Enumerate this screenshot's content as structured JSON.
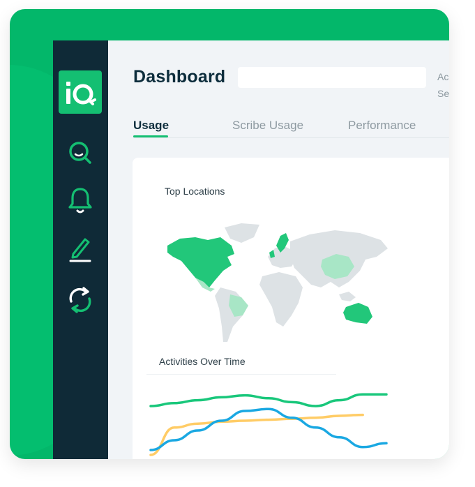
{
  "brand": {
    "logo_text": "iQ",
    "frame_color": "#03b76a",
    "accent": "#14bf72",
    "sidebar_color": "#0f2a37"
  },
  "sidebar": {
    "items": [
      {
        "icon": "search-icon"
      },
      {
        "icon": "bell-icon"
      },
      {
        "icon": "pencil-icon"
      },
      {
        "icon": "refresh-icon"
      }
    ]
  },
  "header": {
    "title": "Dashboard",
    "search_value": "",
    "trunc_1": "Ac",
    "trunc_2": "Se"
  },
  "tabs": [
    {
      "label": "Usage",
      "active": true
    },
    {
      "label": "Scribe Usage",
      "active": false
    },
    {
      "label": "Performance",
      "active": false
    }
  ],
  "top_locations": {
    "title": "Top Locations",
    "highlighted": [
      {
        "region": "North America",
        "level": "high"
      },
      {
        "region": "Scandinavia",
        "level": "high"
      },
      {
        "region": "United Kingdom",
        "level": "high"
      },
      {
        "region": "Australia",
        "level": "high"
      },
      {
        "region": "China",
        "level": "medium"
      },
      {
        "region": "Brazil",
        "level": "medium"
      }
    ],
    "colors": {
      "high": "#22c77a",
      "medium": "#a8e6c6",
      "base": "#dde2e5"
    }
  },
  "chart_data": {
    "type": "line",
    "title": "Activities Over Time",
    "xlabel": "",
    "ylabel": "",
    "grid": false,
    "legend": "none",
    "x": [
      0,
      1,
      2,
      3,
      4,
      5,
      6,
      7,
      8,
      9,
      10
    ],
    "series": [
      {
        "color": "#19c77b",
        "values": [
          50,
          53,
          56,
          59,
          61,
          58,
          54,
          50,
          56,
          62,
          62
        ]
      },
      {
        "color": "#ffcc66",
        "values": [
          0,
          28,
          32,
          34,
          35,
          36,
          37,
          38,
          40,
          41,
          null
        ]
      },
      {
        "color": "#1aa8e2",
        "values": [
          5,
          15,
          25,
          35,
          45,
          47,
          38,
          28,
          18,
          8,
          12
        ]
      }
    ],
    "ylim": [
      0,
      70
    ]
  }
}
